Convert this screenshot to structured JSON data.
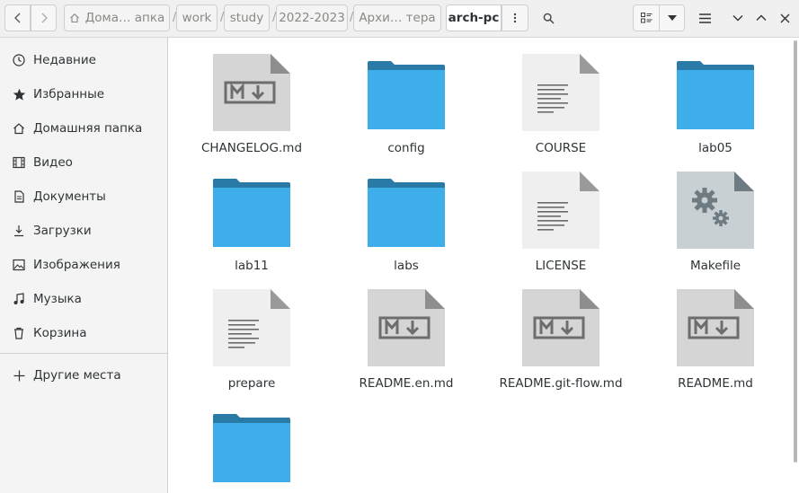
{
  "breadcrumb": {
    "items": [
      {
        "label": "Дома… апка",
        "home": true
      },
      {
        "label": "work"
      },
      {
        "label": "study"
      },
      {
        "label": "2022-2023"
      },
      {
        "label": "Архи… тера"
      },
      {
        "label": "arch-pc",
        "current": true
      }
    ]
  },
  "toolbar": {
    "back_icon": "chevron-left-icon",
    "forward_icon": "chevron-right-icon",
    "path_menu_icon": "vertical-dots-icon",
    "search_icon": "search-icon",
    "view_icon": "list-grid-view-icon",
    "view_dropdown_icon": "triangle-down-icon",
    "menu_icon": "hamburger-icon",
    "minimize_icon": "chevron-down-icon",
    "maximize_icon": "chevron-up-icon",
    "close_icon": "close-icon"
  },
  "sidebar": {
    "items": [
      {
        "label": "Недавние",
        "icon": "clock-icon"
      },
      {
        "label": "Избранные",
        "icon": "star-icon"
      },
      {
        "label": "Домашняя папка",
        "icon": "home-icon"
      },
      {
        "label": "Видео",
        "icon": "film-icon"
      },
      {
        "label": "Документы",
        "icon": "document-icon"
      },
      {
        "label": "Загрузки",
        "icon": "download-icon"
      },
      {
        "label": "Изображения",
        "icon": "image-icon"
      },
      {
        "label": "Музыка",
        "icon": "music-icon"
      },
      {
        "label": "Корзина",
        "icon": "trash-icon"
      }
    ],
    "other": {
      "label": "Другие места",
      "icon": "plus-icon"
    }
  },
  "files": [
    {
      "name": "CHANGELOG.md",
      "type": "markdown"
    },
    {
      "name": "config",
      "type": "folder"
    },
    {
      "name": "COURSE",
      "type": "text"
    },
    {
      "name": "lab05",
      "type": "folder"
    },
    {
      "name": "lab11",
      "type": "folder"
    },
    {
      "name": "labs",
      "type": "folder"
    },
    {
      "name": "LICENSE",
      "type": "text"
    },
    {
      "name": "Makefile",
      "type": "makefile"
    },
    {
      "name": "prepare",
      "type": "text"
    },
    {
      "name": "README.en.md",
      "type": "markdown"
    },
    {
      "name": "README.git-flow.md",
      "type": "markdown"
    },
    {
      "name": "README.md",
      "type": "markdown"
    },
    {
      "name": "",
      "type": "folder"
    }
  ],
  "colors": {
    "folder_front": "#3daee9",
    "folder_back": "#2a7aa8",
    "doc_page": "#efefef",
    "md_page": "#d5d5d5"
  }
}
